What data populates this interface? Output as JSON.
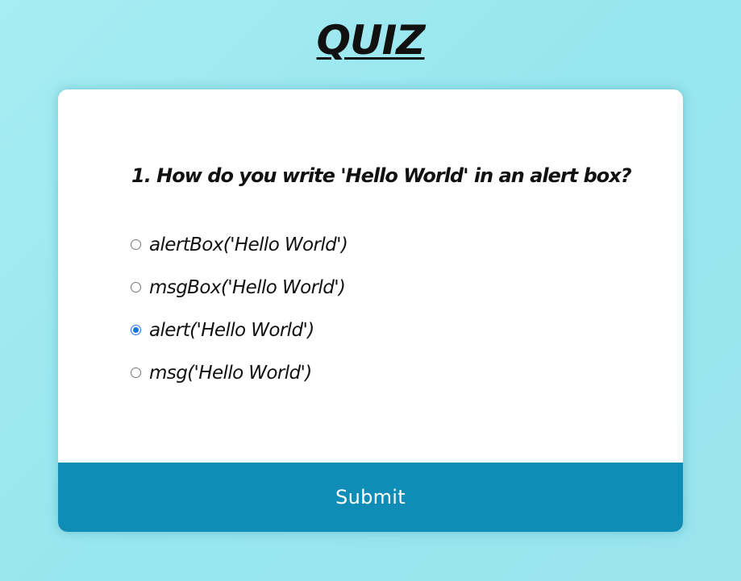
{
  "page": {
    "title": "QUIZ"
  },
  "quiz": {
    "question": "1. How do you write 'Hello World' in an alert box?",
    "answers": [
      {
        "label": "alertBox('Hello World')",
        "checked": false
      },
      {
        "label": "msgBox('Hello World')",
        "checked": false
      },
      {
        "label": "alert('Hello World')",
        "checked": true
      },
      {
        "label": "msg('Hello World')",
        "checked": false
      }
    ],
    "submit_label": "Submit"
  },
  "colors": {
    "background": "#9ee8f0",
    "card": "#ffffff",
    "submit": "#108db6",
    "radio_selected": "#1a73e8"
  }
}
